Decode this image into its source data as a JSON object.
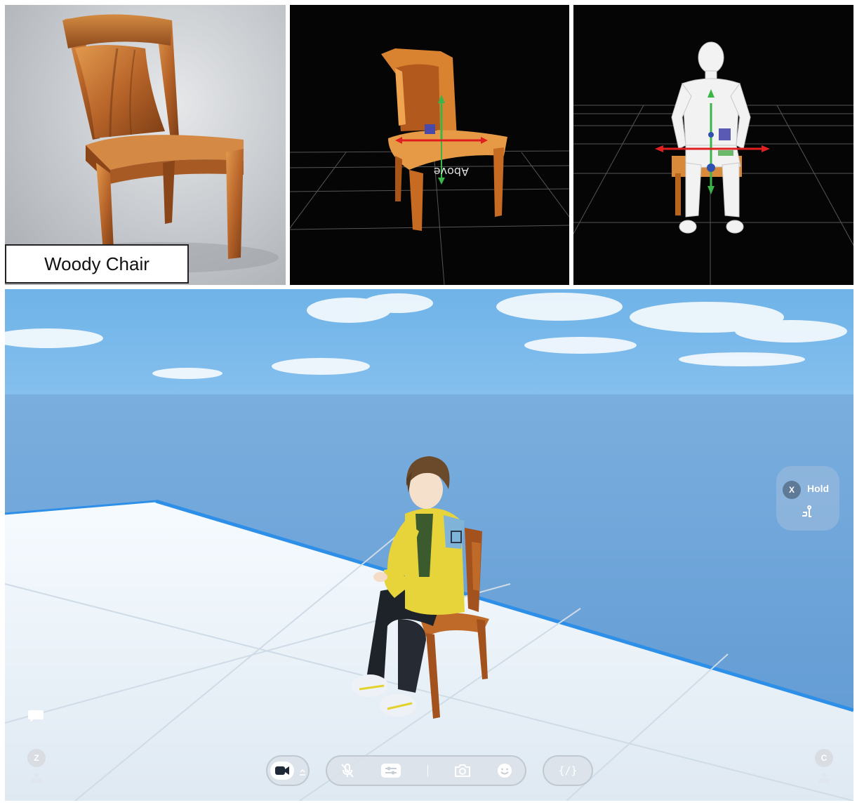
{
  "panel_photo": {
    "caption": "Woody Chair"
  },
  "panel_scene": {
    "hold_prompt": {
      "key": "X",
      "label": "Hold"
    },
    "left_key": "Z",
    "right_key": "C",
    "toolbar": {
      "camera_icon": "video-camera-icon",
      "mic_icon": "microphone-muted-icon",
      "settings_icon": "sliders-icon",
      "screenshot_icon": "camera-icon",
      "emote_icon": "smile-icon",
      "code_icon": "code-braces-icon",
      "code_label": "{/}"
    }
  },
  "colors": {
    "sky_top": "#6fb3e8",
    "floor": "#eef6fb",
    "floor_edge": "#2e8fe8",
    "chair_wood": "#b5652a",
    "jacket": "#e6d43a"
  }
}
